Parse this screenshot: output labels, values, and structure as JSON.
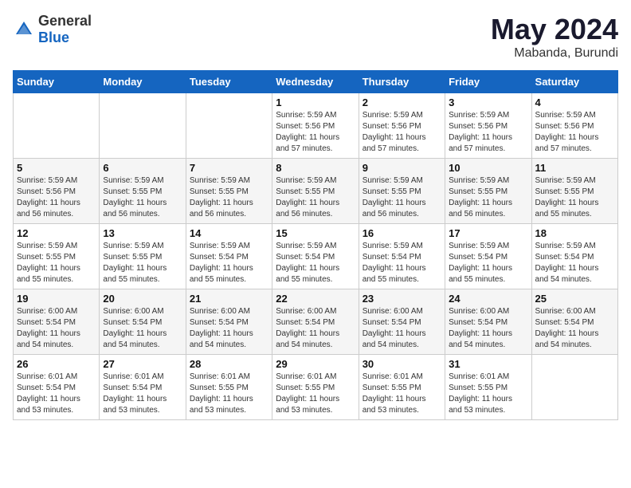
{
  "logo": {
    "text_general": "General",
    "text_blue": "Blue"
  },
  "title": "May 2024",
  "subtitle": "Mabanda, Burundi",
  "days_of_week": [
    "Sunday",
    "Monday",
    "Tuesday",
    "Wednesday",
    "Thursday",
    "Friday",
    "Saturday"
  ],
  "weeks": [
    [
      {
        "day": "",
        "info": ""
      },
      {
        "day": "",
        "info": ""
      },
      {
        "day": "",
        "info": ""
      },
      {
        "day": "1",
        "info": "Sunrise: 5:59 AM\nSunset: 5:56 PM\nDaylight: 11 hours\nand 57 minutes."
      },
      {
        "day": "2",
        "info": "Sunrise: 5:59 AM\nSunset: 5:56 PM\nDaylight: 11 hours\nand 57 minutes."
      },
      {
        "day": "3",
        "info": "Sunrise: 5:59 AM\nSunset: 5:56 PM\nDaylight: 11 hours\nand 57 minutes."
      },
      {
        "day": "4",
        "info": "Sunrise: 5:59 AM\nSunset: 5:56 PM\nDaylight: 11 hours\nand 57 minutes."
      }
    ],
    [
      {
        "day": "5",
        "info": "Sunrise: 5:59 AM\nSunset: 5:56 PM\nDaylight: 11 hours\nand 56 minutes."
      },
      {
        "day": "6",
        "info": "Sunrise: 5:59 AM\nSunset: 5:55 PM\nDaylight: 11 hours\nand 56 minutes."
      },
      {
        "day": "7",
        "info": "Sunrise: 5:59 AM\nSunset: 5:55 PM\nDaylight: 11 hours\nand 56 minutes."
      },
      {
        "day": "8",
        "info": "Sunrise: 5:59 AM\nSunset: 5:55 PM\nDaylight: 11 hours\nand 56 minutes."
      },
      {
        "day": "9",
        "info": "Sunrise: 5:59 AM\nSunset: 5:55 PM\nDaylight: 11 hours\nand 56 minutes."
      },
      {
        "day": "10",
        "info": "Sunrise: 5:59 AM\nSunset: 5:55 PM\nDaylight: 11 hours\nand 56 minutes."
      },
      {
        "day": "11",
        "info": "Sunrise: 5:59 AM\nSunset: 5:55 PM\nDaylight: 11 hours\nand 55 minutes."
      }
    ],
    [
      {
        "day": "12",
        "info": "Sunrise: 5:59 AM\nSunset: 5:55 PM\nDaylight: 11 hours\nand 55 minutes."
      },
      {
        "day": "13",
        "info": "Sunrise: 5:59 AM\nSunset: 5:55 PM\nDaylight: 11 hours\nand 55 minutes."
      },
      {
        "day": "14",
        "info": "Sunrise: 5:59 AM\nSunset: 5:54 PM\nDaylight: 11 hours\nand 55 minutes."
      },
      {
        "day": "15",
        "info": "Sunrise: 5:59 AM\nSunset: 5:54 PM\nDaylight: 11 hours\nand 55 minutes."
      },
      {
        "day": "16",
        "info": "Sunrise: 5:59 AM\nSunset: 5:54 PM\nDaylight: 11 hours\nand 55 minutes."
      },
      {
        "day": "17",
        "info": "Sunrise: 5:59 AM\nSunset: 5:54 PM\nDaylight: 11 hours\nand 55 minutes."
      },
      {
        "day": "18",
        "info": "Sunrise: 5:59 AM\nSunset: 5:54 PM\nDaylight: 11 hours\nand 54 minutes."
      }
    ],
    [
      {
        "day": "19",
        "info": "Sunrise: 6:00 AM\nSunset: 5:54 PM\nDaylight: 11 hours\nand 54 minutes."
      },
      {
        "day": "20",
        "info": "Sunrise: 6:00 AM\nSunset: 5:54 PM\nDaylight: 11 hours\nand 54 minutes."
      },
      {
        "day": "21",
        "info": "Sunrise: 6:00 AM\nSunset: 5:54 PM\nDaylight: 11 hours\nand 54 minutes."
      },
      {
        "day": "22",
        "info": "Sunrise: 6:00 AM\nSunset: 5:54 PM\nDaylight: 11 hours\nand 54 minutes."
      },
      {
        "day": "23",
        "info": "Sunrise: 6:00 AM\nSunset: 5:54 PM\nDaylight: 11 hours\nand 54 minutes."
      },
      {
        "day": "24",
        "info": "Sunrise: 6:00 AM\nSunset: 5:54 PM\nDaylight: 11 hours\nand 54 minutes."
      },
      {
        "day": "25",
        "info": "Sunrise: 6:00 AM\nSunset: 5:54 PM\nDaylight: 11 hours\nand 54 minutes."
      }
    ],
    [
      {
        "day": "26",
        "info": "Sunrise: 6:01 AM\nSunset: 5:54 PM\nDaylight: 11 hours\nand 53 minutes."
      },
      {
        "day": "27",
        "info": "Sunrise: 6:01 AM\nSunset: 5:54 PM\nDaylight: 11 hours\nand 53 minutes."
      },
      {
        "day": "28",
        "info": "Sunrise: 6:01 AM\nSunset: 5:55 PM\nDaylight: 11 hours\nand 53 minutes."
      },
      {
        "day": "29",
        "info": "Sunrise: 6:01 AM\nSunset: 5:55 PM\nDaylight: 11 hours\nand 53 minutes."
      },
      {
        "day": "30",
        "info": "Sunrise: 6:01 AM\nSunset: 5:55 PM\nDaylight: 11 hours\nand 53 minutes."
      },
      {
        "day": "31",
        "info": "Sunrise: 6:01 AM\nSunset: 5:55 PM\nDaylight: 11 hours\nand 53 minutes."
      },
      {
        "day": "",
        "info": ""
      }
    ]
  ]
}
